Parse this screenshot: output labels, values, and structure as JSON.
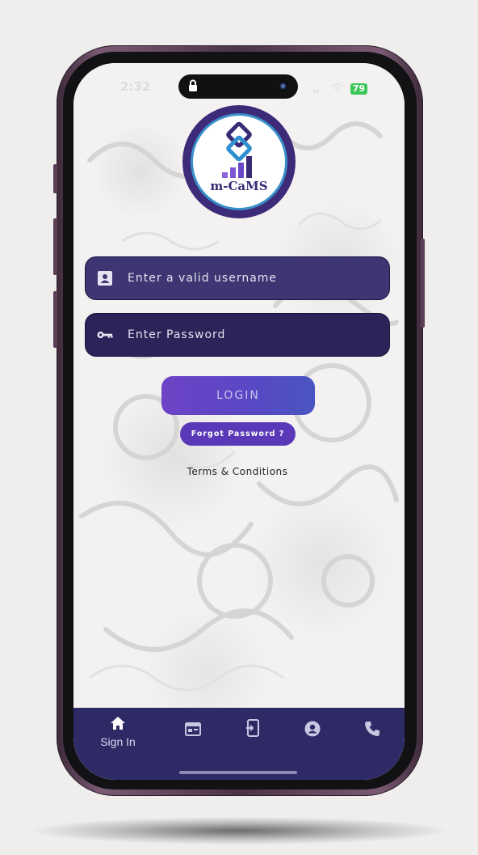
{
  "status_bar": {
    "time": "2:32",
    "battery": "79"
  },
  "logo": {
    "text": "m-CaMS"
  },
  "form": {
    "username_placeholder": "Enter a valid username",
    "password_placeholder": "Enter Password",
    "login_label": "LOGIN",
    "forgot_label": "Forgot Password ?",
    "terms_label": "Terms & Conditions"
  },
  "tabbar": {
    "tabs": [
      {
        "label": "Sign In",
        "icon": "home-icon",
        "active": true
      },
      {
        "label": "",
        "icon": "calendar-icon",
        "active": false
      },
      {
        "label": "",
        "icon": "mobile-login-icon",
        "active": false
      },
      {
        "label": "",
        "icon": "account-icon",
        "active": false
      },
      {
        "label": "",
        "icon": "phone-icon",
        "active": false
      }
    ]
  },
  "colors": {
    "primary": "#2e2a66",
    "accent": "#5a38b8",
    "field_bg": "#3d3673"
  }
}
